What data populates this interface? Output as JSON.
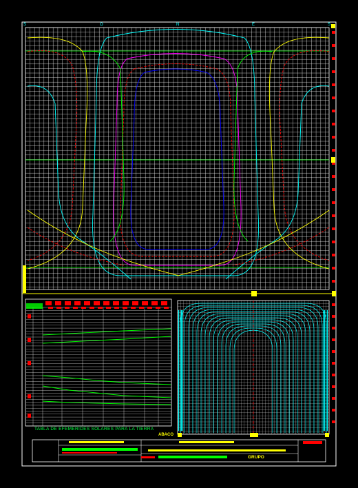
{
  "drawing": {
    "compass_labels": [
      "S",
      "O",
      "N",
      "E",
      "S"
    ],
    "table_caption": "TABLA DE EFEMERIDES SOLARES PARA LA TIERRA",
    "abaco_label": "ABACO",
    "group_label": "GRUPO"
  },
  "colors": {
    "background": "#000000",
    "grid": "#ffffff",
    "frame": "#ffffff",
    "accent_red": "#ff0000",
    "accent_yellow": "#ffff00",
    "accent_green": "#00ff00",
    "accent_cyan": "#00ffff",
    "accent_magenta": "#ff00ff",
    "accent_blue": "#0000ff"
  }
}
